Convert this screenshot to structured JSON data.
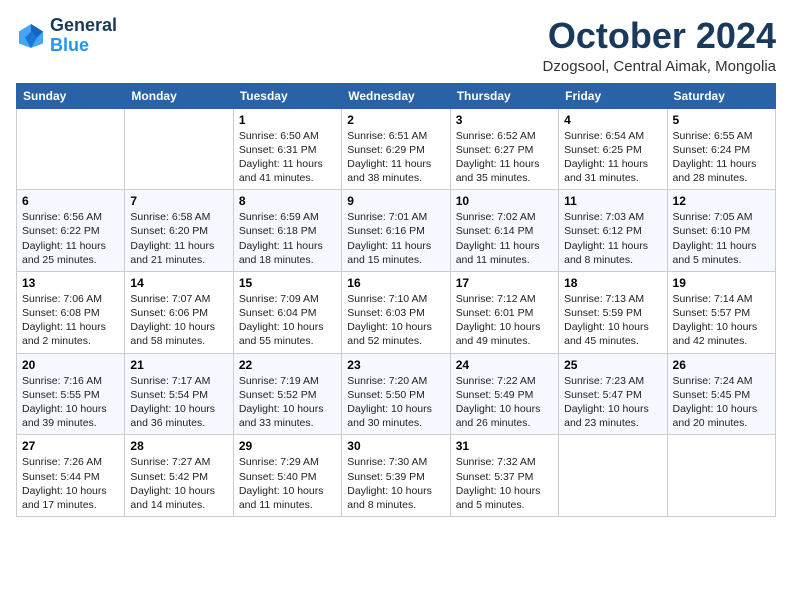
{
  "header": {
    "logo_line1": "General",
    "logo_line2": "Blue",
    "month": "October 2024",
    "location": "Dzogsool, Central Aimak, Mongolia"
  },
  "columns": [
    "Sunday",
    "Monday",
    "Tuesday",
    "Wednesday",
    "Thursday",
    "Friday",
    "Saturday"
  ],
  "weeks": [
    [
      {
        "day": "",
        "info": ""
      },
      {
        "day": "",
        "info": ""
      },
      {
        "day": "1",
        "info": "Sunrise: 6:50 AM\nSunset: 6:31 PM\nDaylight: 11 hours and 41 minutes."
      },
      {
        "day": "2",
        "info": "Sunrise: 6:51 AM\nSunset: 6:29 PM\nDaylight: 11 hours and 38 minutes."
      },
      {
        "day": "3",
        "info": "Sunrise: 6:52 AM\nSunset: 6:27 PM\nDaylight: 11 hours and 35 minutes."
      },
      {
        "day": "4",
        "info": "Sunrise: 6:54 AM\nSunset: 6:25 PM\nDaylight: 11 hours and 31 minutes."
      },
      {
        "day": "5",
        "info": "Sunrise: 6:55 AM\nSunset: 6:24 PM\nDaylight: 11 hours and 28 minutes."
      }
    ],
    [
      {
        "day": "6",
        "info": "Sunrise: 6:56 AM\nSunset: 6:22 PM\nDaylight: 11 hours and 25 minutes."
      },
      {
        "day": "7",
        "info": "Sunrise: 6:58 AM\nSunset: 6:20 PM\nDaylight: 11 hours and 21 minutes."
      },
      {
        "day": "8",
        "info": "Sunrise: 6:59 AM\nSunset: 6:18 PM\nDaylight: 11 hours and 18 minutes."
      },
      {
        "day": "9",
        "info": "Sunrise: 7:01 AM\nSunset: 6:16 PM\nDaylight: 11 hours and 15 minutes."
      },
      {
        "day": "10",
        "info": "Sunrise: 7:02 AM\nSunset: 6:14 PM\nDaylight: 11 hours and 11 minutes."
      },
      {
        "day": "11",
        "info": "Sunrise: 7:03 AM\nSunset: 6:12 PM\nDaylight: 11 hours and 8 minutes."
      },
      {
        "day": "12",
        "info": "Sunrise: 7:05 AM\nSunset: 6:10 PM\nDaylight: 11 hours and 5 minutes."
      }
    ],
    [
      {
        "day": "13",
        "info": "Sunrise: 7:06 AM\nSunset: 6:08 PM\nDaylight: 11 hours and 2 minutes."
      },
      {
        "day": "14",
        "info": "Sunrise: 7:07 AM\nSunset: 6:06 PM\nDaylight: 10 hours and 58 minutes."
      },
      {
        "day": "15",
        "info": "Sunrise: 7:09 AM\nSunset: 6:04 PM\nDaylight: 10 hours and 55 minutes."
      },
      {
        "day": "16",
        "info": "Sunrise: 7:10 AM\nSunset: 6:03 PM\nDaylight: 10 hours and 52 minutes."
      },
      {
        "day": "17",
        "info": "Sunrise: 7:12 AM\nSunset: 6:01 PM\nDaylight: 10 hours and 49 minutes."
      },
      {
        "day": "18",
        "info": "Sunrise: 7:13 AM\nSunset: 5:59 PM\nDaylight: 10 hours and 45 minutes."
      },
      {
        "day": "19",
        "info": "Sunrise: 7:14 AM\nSunset: 5:57 PM\nDaylight: 10 hours and 42 minutes."
      }
    ],
    [
      {
        "day": "20",
        "info": "Sunrise: 7:16 AM\nSunset: 5:55 PM\nDaylight: 10 hours and 39 minutes."
      },
      {
        "day": "21",
        "info": "Sunrise: 7:17 AM\nSunset: 5:54 PM\nDaylight: 10 hours and 36 minutes."
      },
      {
        "day": "22",
        "info": "Sunrise: 7:19 AM\nSunset: 5:52 PM\nDaylight: 10 hours and 33 minutes."
      },
      {
        "day": "23",
        "info": "Sunrise: 7:20 AM\nSunset: 5:50 PM\nDaylight: 10 hours and 30 minutes."
      },
      {
        "day": "24",
        "info": "Sunrise: 7:22 AM\nSunset: 5:49 PM\nDaylight: 10 hours and 26 minutes."
      },
      {
        "day": "25",
        "info": "Sunrise: 7:23 AM\nSunset: 5:47 PM\nDaylight: 10 hours and 23 minutes."
      },
      {
        "day": "26",
        "info": "Sunrise: 7:24 AM\nSunset: 5:45 PM\nDaylight: 10 hours and 20 minutes."
      }
    ],
    [
      {
        "day": "27",
        "info": "Sunrise: 7:26 AM\nSunset: 5:44 PM\nDaylight: 10 hours and 17 minutes."
      },
      {
        "day": "28",
        "info": "Sunrise: 7:27 AM\nSunset: 5:42 PM\nDaylight: 10 hours and 14 minutes."
      },
      {
        "day": "29",
        "info": "Sunrise: 7:29 AM\nSunset: 5:40 PM\nDaylight: 10 hours and 11 minutes."
      },
      {
        "day": "30",
        "info": "Sunrise: 7:30 AM\nSunset: 5:39 PM\nDaylight: 10 hours and 8 minutes."
      },
      {
        "day": "31",
        "info": "Sunrise: 7:32 AM\nSunset: 5:37 PM\nDaylight: 10 hours and 5 minutes."
      },
      {
        "day": "",
        "info": ""
      },
      {
        "day": "",
        "info": ""
      }
    ]
  ]
}
